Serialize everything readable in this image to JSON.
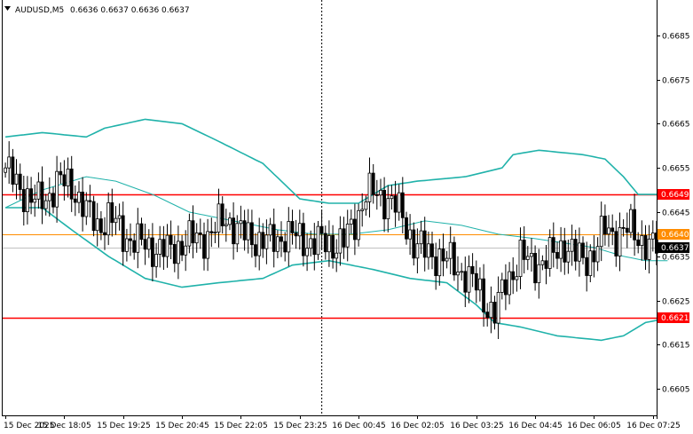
{
  "header": {
    "symbol": "AUDUSD,M5",
    "ohlc": "0.6636 0.6637 0.6636 0.6637"
  },
  "colors": {
    "background": "#ffffff",
    "candle": "#000000",
    "bollinger": "#20b2aa",
    "support_resistance": "#ff0000",
    "pivot": "#ff8c00",
    "bid_line": "#c0c0c0",
    "bid_tag_bg": "#000000",
    "level_tag_bg": "#ff0000",
    "grid": "#000000"
  },
  "chart_data": {
    "type": "candlestick",
    "grid": false,
    "y_ticks": [
      "0.6685",
      "0.6675",
      "0.6665",
      "0.6655",
      "0.6645",
      "0.6635",
      "0.6625",
      "0.6615",
      "0.6605"
    ],
    "y_tick_values": [
      0.6685,
      0.6675,
      0.6665,
      0.6655,
      0.6645,
      0.6635,
      0.6625,
      0.6615,
      0.6605
    ],
    "ylim": [
      0.6599,
      0.6693
    ],
    "x_ticks": [
      "15 Dec 2025",
      "15 Dec 18:05",
      "15 Dec 19:25",
      "15 Dec 20:45",
      "15 Dec 22:05",
      "15 Dec 23:25",
      "16 Dec 00:45",
      "16 Dec 02:05",
      "16 Dec 03:25",
      "16 Dec 04:45",
      "16 Dec 06:05",
      "16 Dec 07:25"
    ],
    "x_tick_index": [
      0,
      16,
      32,
      48,
      64,
      80,
      96,
      112,
      128,
      144,
      160,
      176
    ],
    "bar_count": 178,
    "session_separator_index": 86,
    "levels": [
      {
        "label": "0.6649",
        "value": 0.6649,
        "kind": "resistance"
      },
      {
        "label": "0.6640",
        "value": 0.664,
        "kind": "pivot"
      },
      {
        "label": "0.6621",
        "value": 0.6621,
        "kind": "support"
      }
    ],
    "bid": {
      "label": "0.6637",
      "value": 0.6637
    },
    "close_anchors": [
      [
        0,
        0.6655
      ],
      [
        3,
        0.6651
      ],
      [
        6,
        0.6649
      ],
      [
        9,
        0.6647
      ],
      [
        11,
        0.6648
      ],
      [
        14,
        0.6652
      ],
      [
        17,
        0.6651
      ],
      [
        19,
        0.665
      ],
      [
        22,
        0.6645
      ],
      [
        25,
        0.6642
      ],
      [
        28,
        0.6644
      ],
      [
        32,
        0.664
      ],
      [
        36,
        0.6638
      ],
      [
        40,
        0.6637
      ],
      [
        44,
        0.6636
      ],
      [
        48,
        0.6638
      ],
      [
        52,
        0.6639
      ],
      [
        56,
        0.664
      ],
      [
        60,
        0.6644
      ],
      [
        64,
        0.664
      ],
      [
        68,
        0.6639
      ],
      [
        72,
        0.6638
      ],
      [
        76,
        0.664
      ],
      [
        80,
        0.6639
      ],
      [
        84,
        0.6638
      ],
      [
        88,
        0.6638
      ],
      [
        92,
        0.6638
      ],
      [
        95,
        0.6643
      ],
      [
        98,
        0.6649
      ],
      [
        101,
        0.6649
      ],
      [
        104,
        0.6648
      ],
      [
        108,
        0.6644
      ],
      [
        111,
        0.6638
      ],
      [
        114,
        0.6636
      ],
      [
        118,
        0.6635
      ],
      [
        122,
        0.6633
      ],
      [
        125,
        0.6631
      ],
      [
        128,
        0.6628
      ],
      [
        131,
        0.6624
      ],
      [
        133,
        0.6622
      ],
      [
        134,
        0.6624
      ],
      [
        136,
        0.6629
      ],
      [
        138,
        0.6632
      ],
      [
        140,
        0.6635
      ],
      [
        143,
        0.6633
      ],
      [
        146,
        0.6634
      ],
      [
        149,
        0.6635
      ],
      [
        152,
        0.6638
      ],
      [
        155,
        0.6635
      ],
      [
        157,
        0.6634
      ],
      [
        160,
        0.6636
      ],
      [
        163,
        0.6641
      ],
      [
        166,
        0.664
      ],
      [
        170,
        0.6641
      ],
      [
        173,
        0.6639
      ],
      [
        175,
        0.6637
      ],
      [
        177,
        0.6637
      ]
    ],
    "bollinger_upper": [
      [
        0,
        0.6662
      ],
      [
        10,
        0.6663
      ],
      [
        22,
        0.6662
      ],
      [
        27,
        0.6664
      ],
      [
        38,
        0.6666
      ],
      [
        48,
        0.6665
      ],
      [
        58,
        0.6661
      ],
      [
        70,
        0.6656
      ],
      [
        80,
        0.6648
      ],
      [
        88,
        0.6647
      ],
      [
        96,
        0.6647
      ],
      [
        104,
        0.6651
      ],
      [
        112,
        0.6652
      ],
      [
        125,
        0.6653
      ],
      [
        135,
        0.6655
      ],
      [
        138,
        0.6658
      ],
      [
        145,
        0.6659
      ],
      [
        157,
        0.6658
      ],
      [
        163,
        0.6657
      ],
      [
        168,
        0.6653
      ],
      [
        172,
        0.6649
      ],
      [
        180,
        0.6649
      ]
    ],
    "bollinger_middle": [
      [
        0,
        0.6646
      ],
      [
        10,
        0.665
      ],
      [
        22,
        0.6653
      ],
      [
        30,
        0.6652
      ],
      [
        40,
        0.6649
      ],
      [
        50,
        0.6645
      ],
      [
        62,
        0.6643
      ],
      [
        74,
        0.6641
      ],
      [
        84,
        0.664
      ],
      [
        94,
        0.664
      ],
      [
        104,
        0.6641
      ],
      [
        114,
        0.6643
      ],
      [
        124,
        0.6642
      ],
      [
        134,
        0.664
      ],
      [
        144,
        0.6639
      ],
      [
        152,
        0.6638
      ],
      [
        160,
        0.6637
      ],
      [
        168,
        0.6635
      ],
      [
        174,
        0.6634
      ],
      [
        180,
        0.6634
      ]
    ],
    "bollinger_lower": [
      [
        0,
        0.6646
      ],
      [
        10,
        0.6646
      ],
      [
        18,
        0.6641
      ],
      [
        28,
        0.6635
      ],
      [
        38,
        0.663
      ],
      [
        48,
        0.6628
      ],
      [
        58,
        0.6629
      ],
      [
        70,
        0.663
      ],
      [
        78,
        0.6633
      ],
      [
        88,
        0.6634
      ],
      [
        100,
        0.6632
      ],
      [
        110,
        0.663
      ],
      [
        120,
        0.6629
      ],
      [
        128,
        0.6624
      ],
      [
        133,
        0.662
      ],
      [
        140,
        0.6619
      ],
      [
        150,
        0.6617
      ],
      [
        162,
        0.6616
      ],
      [
        168,
        0.6617
      ],
      [
        174,
        0.662
      ],
      [
        180,
        0.6621
      ]
    ]
  }
}
